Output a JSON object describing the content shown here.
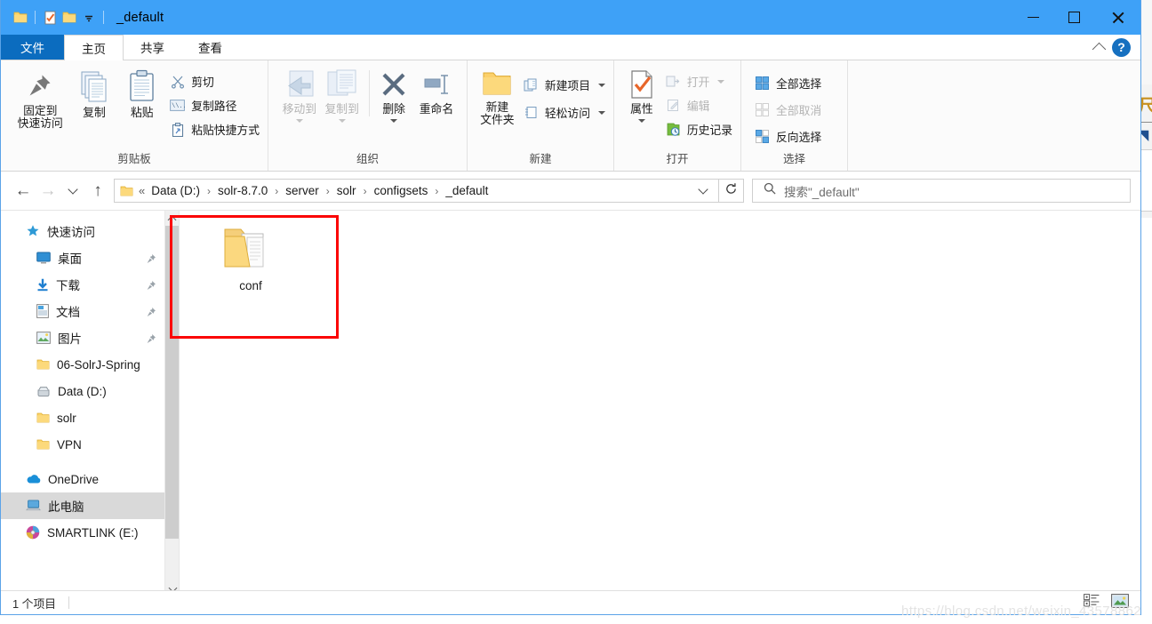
{
  "window": {
    "title": "_default",
    "quick_access_icons": [
      "folder-icon",
      "properties-check-icon",
      "new-folder-icon",
      "customize-qat-dropdown-icon"
    ],
    "controls": {
      "minimize": "minimize-icon",
      "maximize": "maximize-icon",
      "close": "close-icon"
    },
    "titlebar_color": "#3ea1f7"
  },
  "ribbon": {
    "tabs": [
      {
        "label": "文件",
        "name": "tab-file"
      },
      {
        "label": "主页",
        "name": "tab-home"
      },
      {
        "label": "共享",
        "name": "tab-share"
      },
      {
        "label": "查看",
        "name": "tab-view"
      }
    ],
    "active_tab": "主页",
    "collapse_icon": "chevron-up-icon",
    "help_icon": "help-icon",
    "help_label": "?",
    "groups": [
      {
        "title": "剪贴板",
        "big_buttons": [
          {
            "label": "固定到\n快速访问",
            "line1": "固定到",
            "line2": "快速访问",
            "icon": "pin-icon",
            "disabled": false
          },
          {
            "label": "复制",
            "icon": "copy-icon",
            "disabled": false
          },
          {
            "label": "粘贴",
            "icon": "paste-icon",
            "disabled": false
          }
        ],
        "small_buttons": [
          {
            "label": "剪切",
            "icon": "scissors-icon",
            "disabled": false
          },
          {
            "label": "复制路径",
            "icon": "copy-path-icon",
            "disabled": false
          },
          {
            "label": "粘贴快捷方式",
            "icon": "paste-shortcut-icon",
            "disabled": false
          }
        ]
      },
      {
        "title": "组织",
        "big_buttons": [
          {
            "label": "移动到",
            "icon": "move-to-icon",
            "disabled": true,
            "has_caret": true
          },
          {
            "label": "复制到",
            "icon": "copy-to-icon",
            "disabled": true,
            "has_caret": true
          },
          {
            "label": "删除",
            "icon": "delete-icon",
            "disabled": false,
            "has_caret": true
          },
          {
            "label": "重命名",
            "icon": "rename-icon",
            "disabled": false
          }
        ]
      },
      {
        "title": "新建",
        "big_buttons": [
          {
            "line1": "新建",
            "line2": "文件夹",
            "label": "新建文件夹",
            "icon": "new-folder-icon",
            "disabled": false
          }
        ],
        "small_buttons": [
          {
            "label": "新建项目",
            "icon": "new-item-icon",
            "disabled": false,
            "has_caret": true
          },
          {
            "label": "轻松访问",
            "icon": "easy-access-icon",
            "disabled": false,
            "has_caret": true
          }
        ]
      },
      {
        "title": "打开",
        "big_buttons": [
          {
            "label": "属性",
            "icon": "properties-icon",
            "disabled": false,
            "has_caret": true
          }
        ],
        "small_buttons": [
          {
            "label": "打开",
            "icon": "open-icon",
            "disabled": true,
            "has_caret": true
          },
          {
            "label": "编辑",
            "icon": "edit-icon",
            "disabled": true
          },
          {
            "label": "历史记录",
            "icon": "history-icon",
            "disabled": false
          }
        ]
      },
      {
        "title": "选择",
        "small_buttons": [
          {
            "label": "全部选择",
            "icon": "select-all-icon",
            "disabled": false
          },
          {
            "label": "全部取消",
            "icon": "select-none-icon",
            "disabled": true
          },
          {
            "label": "反向选择",
            "icon": "invert-selection-icon",
            "disabled": false
          }
        ]
      }
    ]
  },
  "addressbar": {
    "back_icon": "arrow-left-icon",
    "forward_icon": "arrow-right-icon",
    "recent_icon": "chevron-down-icon",
    "up_icon": "arrow-up-icon",
    "folder_icon": "folder-icon",
    "overflow": "«",
    "breadcrumbs": [
      "Data (D:)",
      "solr-8.7.0",
      "server",
      "solr",
      "configsets",
      "_default"
    ],
    "separator": "›",
    "dropdown_icon": "chevron-down-icon",
    "refresh_icon": "refresh-icon",
    "search": {
      "icon": "search-icon",
      "placeholder": "搜索\"_default\"",
      "value": ""
    }
  },
  "navpane": {
    "scrollbar": {
      "up_icon": "chevron-up-icon",
      "down_icon": "chevron-down-icon"
    },
    "items": [
      {
        "label": "快速访问",
        "icon": "quick-access-star-icon",
        "indent": false,
        "pinned": false,
        "selected": false
      },
      {
        "label": "桌面",
        "icon": "desktop-icon",
        "indent": true,
        "pinned": true,
        "selected": false
      },
      {
        "label": "下载",
        "icon": "downloads-icon",
        "indent": true,
        "pinned": true,
        "selected": false
      },
      {
        "label": "文档",
        "icon": "documents-icon",
        "indent": true,
        "pinned": true,
        "selected": false
      },
      {
        "label": "图片",
        "icon": "pictures-icon",
        "indent": true,
        "pinned": true,
        "selected": false
      },
      {
        "label": "06-SolrJ-Spring",
        "icon": "folder-icon",
        "indent": true,
        "pinned": false,
        "selected": false
      },
      {
        "label": "Data (D:)",
        "icon": "drive-icon",
        "indent": true,
        "pinned": false,
        "selected": false
      },
      {
        "label": "solr",
        "icon": "folder-icon",
        "indent": true,
        "pinned": false,
        "selected": false
      },
      {
        "label": "VPN",
        "icon": "folder-icon",
        "indent": true,
        "pinned": false,
        "selected": false
      },
      {
        "label": "OneDrive",
        "icon": "onedrive-cloud-icon",
        "indent": false,
        "pinned": false,
        "selected": false
      },
      {
        "label": "此电脑",
        "icon": "this-pc-icon",
        "indent": false,
        "pinned": false,
        "selected": true
      },
      {
        "label": "SMARTLINK (E:)",
        "icon": "cd-drive-icon",
        "indent": false,
        "pinned": false,
        "selected": false
      }
    ]
  },
  "content": {
    "items": [
      {
        "name": "conf",
        "icon": "open-folder-with-files-icon",
        "type": "folder"
      }
    ],
    "annotation": {
      "shape": "rectangle",
      "color": "#fb0404"
    }
  },
  "statusbar": {
    "item_count": "1 个项目",
    "view_buttons": [
      {
        "name": "details-view-button",
        "icon": "details-view-icon",
        "active": false
      },
      {
        "name": "large-icons-view-button",
        "icon": "large-icons-view-icon",
        "active": true
      }
    ]
  },
  "watermark": "https://blog.csdn.net/weixin_43578862"
}
